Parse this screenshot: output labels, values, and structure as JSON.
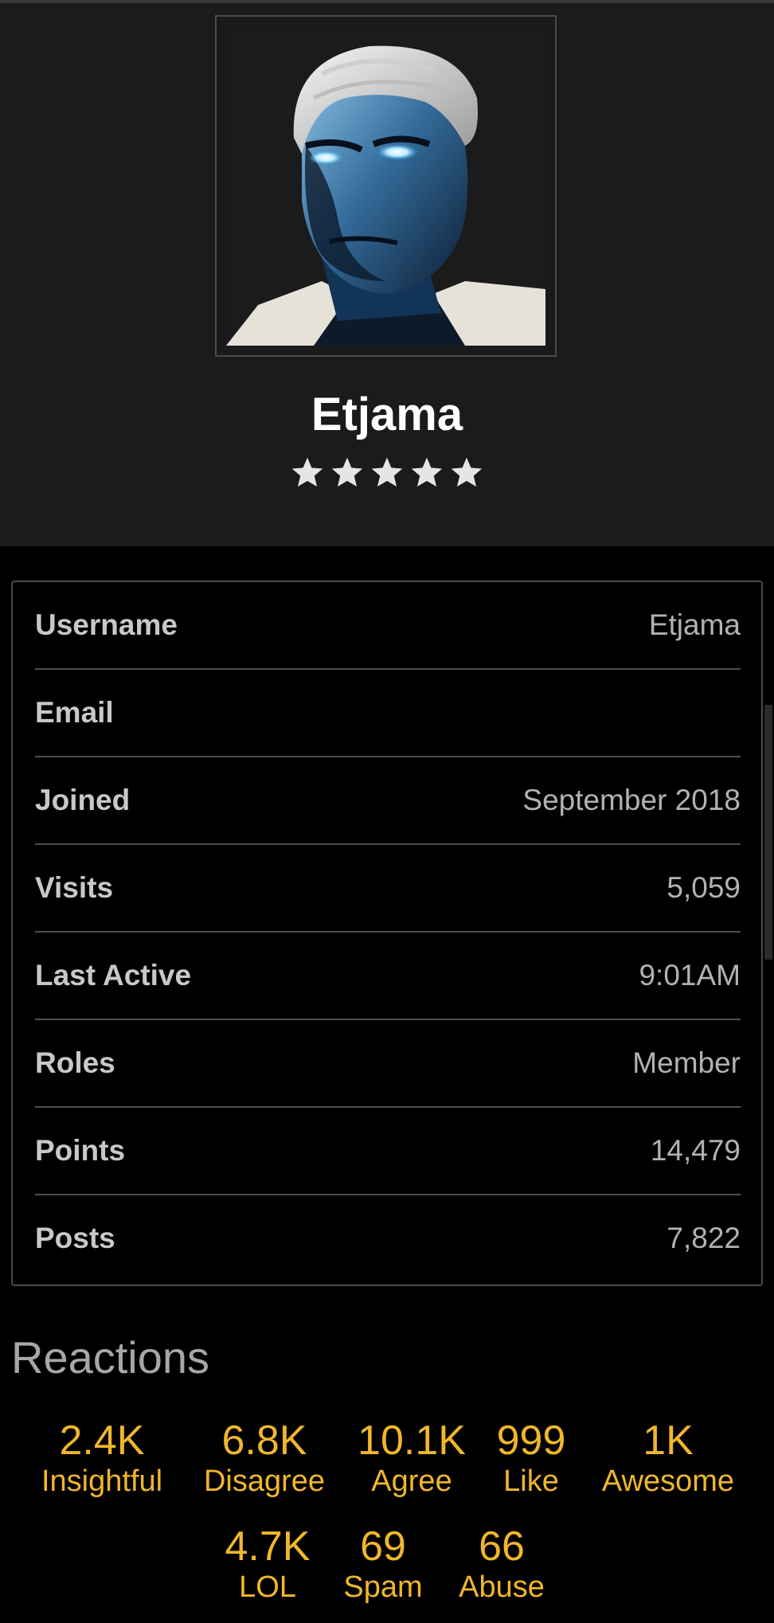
{
  "profile": {
    "username": "Etjama",
    "star_count": 5,
    "avatar_icon": "avatar-character-portrait"
  },
  "info": {
    "rows": [
      {
        "label": "Username",
        "value": "Etjama"
      },
      {
        "label": "Email",
        "value": ""
      },
      {
        "label": "Joined",
        "value": "September 2018"
      },
      {
        "label": "Visits",
        "value": "5,059"
      },
      {
        "label": "Last Active",
        "value": "9:01AM"
      },
      {
        "label": "Roles",
        "value": "Member"
      },
      {
        "label": "Points",
        "value": "14,479"
      },
      {
        "label": "Posts",
        "value": "7,822"
      }
    ]
  },
  "reactions": {
    "title": "Reactions",
    "items": [
      {
        "count": "2.4K",
        "label": "Insightful"
      },
      {
        "count": "6.8K",
        "label": "Disagree"
      },
      {
        "count": "10.1K",
        "label": "Agree"
      },
      {
        "count": "999",
        "label": "Like"
      },
      {
        "count": "1K",
        "label": "Awesome"
      },
      {
        "count": "4.7K",
        "label": "LOL"
      },
      {
        "count": "69",
        "label": "Spam"
      },
      {
        "count": "66",
        "label": "Abuse"
      }
    ]
  },
  "colors": {
    "header_bg": "#1b1b1c",
    "page_bg": "#000000",
    "reaction_accent": "#f0b62c",
    "border": "#4a4a4a"
  }
}
